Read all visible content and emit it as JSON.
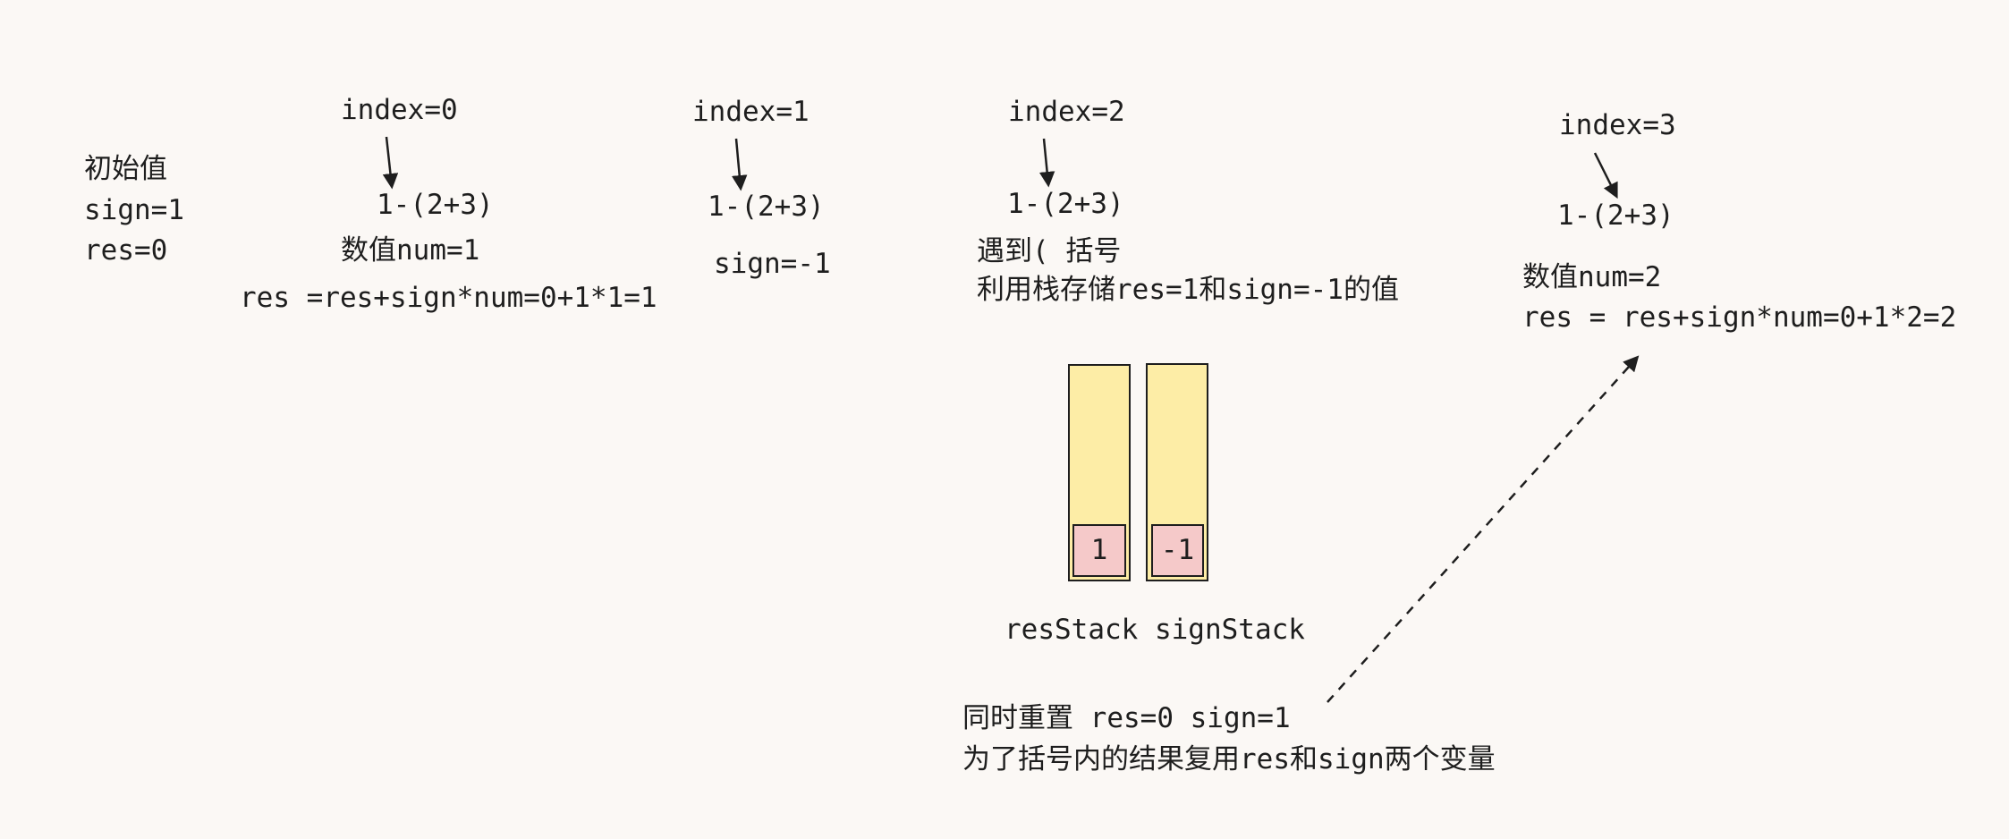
{
  "init": {
    "title": "初始值",
    "sign": "sign=1",
    "res": "res=0"
  },
  "step0": {
    "index": "index=0",
    "expr": "1-(2+3)",
    "num": "数值num=1",
    "calc": "res =res+sign*num=0+1*1=1"
  },
  "step1": {
    "index": "index=1",
    "expr": "1-(2+3)",
    "sign": "sign=-1"
  },
  "step2": {
    "index": "index=2",
    "expr": "1-(2+3)",
    "note1": "遇到( 括号",
    "note2": "利用栈存储res=1和sign=-1的值"
  },
  "step3": {
    "index": "index=3",
    "expr": "1-(2+3)",
    "num": "数值num=2",
    "calc": "res = res+sign*num=0+1*2=2"
  },
  "stacks": {
    "res_value": "1",
    "sign_value": "-1",
    "label": "resStack signStack"
  },
  "reset": {
    "line1": "同时重置 res=0 sign=1",
    "line2": "为了括号内的结果复用res和sign两个变量"
  },
  "colors": {
    "background": "#fbf8f5",
    "stack_fill": "#fdeda6",
    "cell_fill": "#f5c9c9",
    "stroke": "#1e1e1e"
  }
}
